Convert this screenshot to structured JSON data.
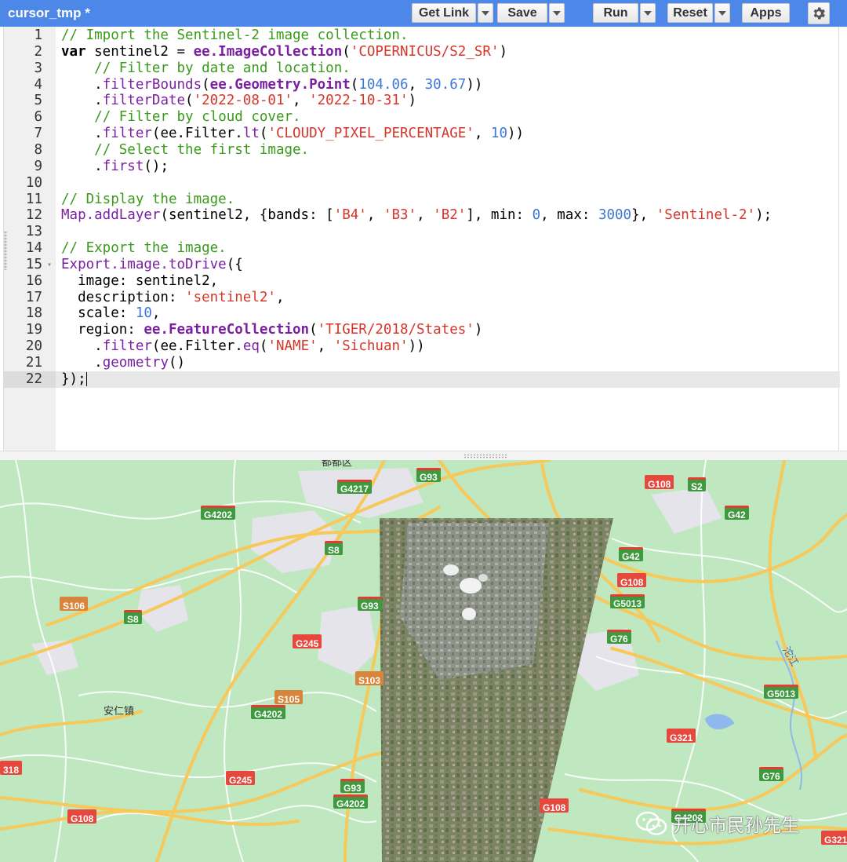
{
  "toolbar": {
    "title": "cursor_tmp *",
    "get_link_label": "Get Link",
    "save_label": "Save",
    "run_label": "Run",
    "reset_label": "Reset",
    "apps_label": "Apps",
    "settings_icon": "gear-icon"
  },
  "editor": {
    "active_line": 22,
    "lines": [
      {
        "n": "1",
        "tokens": [
          [
            "cm",
            "// Import the Sentinel-2 image collection."
          ]
        ]
      },
      {
        "n": "2",
        "tokens": [
          [
            "kw",
            "var"
          ],
          [
            "tx",
            " sentinel2 = "
          ],
          [
            "bi",
            "ee.ImageCollection"
          ],
          [
            "tx",
            "("
          ],
          [
            "st",
            "'COPERNICUS/S2_SR'"
          ],
          [
            "tx",
            ")"
          ]
        ]
      },
      {
        "n": "3",
        "tokens": [
          [
            "tx",
            "    "
          ],
          [
            "cm",
            "// Filter by date and location."
          ]
        ]
      },
      {
        "n": "4",
        "tokens": [
          [
            "tx",
            "    ."
          ],
          [
            "fn",
            "filterBounds"
          ],
          [
            "tx",
            "("
          ],
          [
            "bi",
            "ee.Geometry.Point"
          ],
          [
            "tx",
            "("
          ],
          [
            "nm",
            "104.06"
          ],
          [
            "tx",
            ", "
          ],
          [
            "nm",
            "30.67"
          ],
          [
            "tx",
            "))"
          ]
        ]
      },
      {
        "n": "5",
        "tokens": [
          [
            "tx",
            "    ."
          ],
          [
            "fn",
            "filterDate"
          ],
          [
            "tx",
            "("
          ],
          [
            "st",
            "'2022-08-01'"
          ],
          [
            "tx",
            ", "
          ],
          [
            "st",
            "'2022-10-31'"
          ],
          [
            "tx",
            ")"
          ]
        ]
      },
      {
        "n": "6",
        "tokens": [
          [
            "tx",
            "    "
          ],
          [
            "cm",
            "// Filter by cloud cover."
          ]
        ]
      },
      {
        "n": "7",
        "tokens": [
          [
            "tx",
            "    ."
          ],
          [
            "fn",
            "filter"
          ],
          [
            "tx",
            "(ee.Filter."
          ],
          [
            "fn",
            "lt"
          ],
          [
            "tx",
            "("
          ],
          [
            "st",
            "'CLOUDY_PIXEL_PERCENTAGE'"
          ],
          [
            "tx",
            ", "
          ],
          [
            "nm",
            "10"
          ],
          [
            "tx",
            "))"
          ]
        ]
      },
      {
        "n": "8",
        "tokens": [
          [
            "tx",
            "    "
          ],
          [
            "cm",
            "// Select the first image."
          ]
        ]
      },
      {
        "n": "9",
        "tokens": [
          [
            "tx",
            "    ."
          ],
          [
            "fn",
            "first"
          ],
          [
            "tx",
            "();"
          ]
        ]
      },
      {
        "n": "10",
        "tokens": []
      },
      {
        "n": "11",
        "tokens": [
          [
            "cm",
            "// Display the image."
          ]
        ]
      },
      {
        "n": "12",
        "tokens": [
          [
            "fn",
            "Map.addLayer"
          ],
          [
            "tx",
            "(sentinel2, {bands: ["
          ],
          [
            "st",
            "'B4'"
          ],
          [
            "tx",
            ", "
          ],
          [
            "st",
            "'B3'"
          ],
          [
            "tx",
            ", "
          ],
          [
            "st",
            "'B2'"
          ],
          [
            "tx",
            "], min: "
          ],
          [
            "nm",
            "0"
          ],
          [
            "tx",
            ", max: "
          ],
          [
            "nm",
            "3000"
          ],
          [
            "tx",
            "}, "
          ],
          [
            "st",
            "'Sentinel-2'"
          ],
          [
            "tx",
            ");"
          ]
        ]
      },
      {
        "n": "13",
        "tokens": []
      },
      {
        "n": "14",
        "tokens": [
          [
            "cm",
            "// Export the image."
          ]
        ]
      },
      {
        "n": "15",
        "fold": true,
        "tokens": [
          [
            "fn",
            "Export.image.toDrive"
          ],
          [
            "tx",
            "({"
          ]
        ]
      },
      {
        "n": "16",
        "tokens": [
          [
            "tx",
            "  image: sentinel2,"
          ]
        ]
      },
      {
        "n": "17",
        "tokens": [
          [
            "tx",
            "  description: "
          ],
          [
            "st",
            "'sentinel2'"
          ],
          [
            "tx",
            ","
          ]
        ]
      },
      {
        "n": "18",
        "tokens": [
          [
            "tx",
            "  scale: "
          ],
          [
            "nm",
            "10"
          ],
          [
            "tx",
            ","
          ]
        ]
      },
      {
        "n": "19",
        "tokens": [
          [
            "tx",
            "  region: "
          ],
          [
            "bi",
            "ee.FeatureCollection"
          ],
          [
            "tx",
            "("
          ],
          [
            "st",
            "'TIGER/2018/States'"
          ],
          [
            "tx",
            ")"
          ]
        ]
      },
      {
        "n": "20",
        "tokens": [
          [
            "tx",
            "    ."
          ],
          [
            "fn",
            "filter"
          ],
          [
            "tx",
            "(ee.Filter."
          ],
          [
            "fn",
            "eq"
          ],
          [
            "tx",
            "("
          ],
          [
            "st",
            "'NAME'"
          ],
          [
            "tx",
            ", "
          ],
          [
            "st",
            "'Sichuan'"
          ],
          [
            "tx",
            "))"
          ]
        ]
      },
      {
        "n": "21",
        "tokens": [
          [
            "tx",
            "    ."
          ],
          [
            "fn",
            "geometry"
          ],
          [
            "tx",
            "()"
          ]
        ]
      },
      {
        "n": "22",
        "tokens": [
          [
            "tx",
            "});"
          ]
        ]
      }
    ]
  },
  "map": {
    "shields": [
      {
        "label": "G93",
        "style": "green"
      },
      {
        "label": "G4217",
        "style": "green"
      },
      {
        "label": "G108",
        "style": "red"
      },
      {
        "label": "S2",
        "style": "green"
      },
      {
        "label": "G42",
        "style": "green"
      },
      {
        "label": "G4202",
        "style": "green"
      },
      {
        "label": "S8",
        "style": "green"
      },
      {
        "label": "G42",
        "style": "green"
      },
      {
        "label": "G108",
        "style": "red"
      },
      {
        "label": "S106",
        "style": "orange"
      },
      {
        "label": "S8",
        "style": "green"
      },
      {
        "label": "G93",
        "style": "green"
      },
      {
        "label": "G5013",
        "style": "green"
      },
      {
        "label": "G245",
        "style": "red"
      },
      {
        "label": "G76",
        "style": "green"
      },
      {
        "label": "S103",
        "style": "orange"
      },
      {
        "label": "S105",
        "style": "orange"
      },
      {
        "label": "G5013",
        "style": "green"
      },
      {
        "label": "G4202",
        "style": "green"
      },
      {
        "label": "G321",
        "style": "red"
      },
      {
        "label": "318",
        "style": "red"
      },
      {
        "label": "G245",
        "style": "red"
      },
      {
        "label": "G93",
        "style": "green"
      },
      {
        "label": "G4202",
        "style": "green"
      },
      {
        "label": "G76",
        "style": "green"
      },
      {
        "label": "G108",
        "style": "red"
      },
      {
        "label": "G108",
        "style": "red"
      },
      {
        "label": "G4202",
        "style": "green"
      },
      {
        "label": "G321",
        "style": "red"
      }
    ],
    "places": [
      {
        "label": "安仁镇"
      },
      {
        "label": "都都区"
      },
      {
        "label": "沱江"
      }
    ],
    "watermark": "开心市民孙先生",
    "colors": {
      "land": "#bfe7c0",
      "highway": "#f7c85a",
      "urban": "#e4e4ea",
      "water": "#8fb8ec"
    }
  }
}
